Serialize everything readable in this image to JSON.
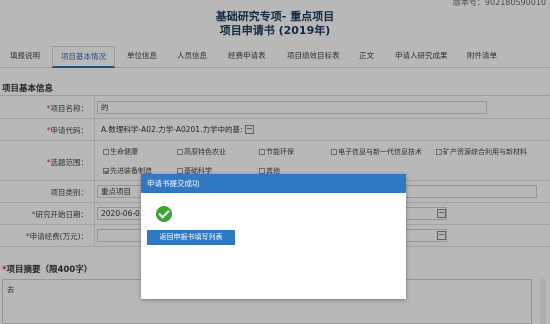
{
  "version_text": "版本号：902180590010",
  "header": {
    "title_line1": "基础研究专项- 重点项目",
    "title_line2": "项目申请书 (2019年)"
  },
  "tabs": [
    {
      "label": "填报说明",
      "active": false
    },
    {
      "label": "项目基本情况",
      "active": true
    },
    {
      "label": "单位信息",
      "active": false
    },
    {
      "label": "人员信息",
      "active": false
    },
    {
      "label": "经费申请表",
      "active": false
    },
    {
      "label": "项目绩效目标表",
      "active": false
    },
    {
      "label": "正文",
      "active": false
    },
    {
      "label": "申请人研究成果",
      "active": false
    },
    {
      "label": "附件清单",
      "active": false
    }
  ],
  "section_title": "项目基本信息",
  "form": {
    "project_name": {
      "label": "项目名称：",
      "required": "*",
      "value": "的"
    },
    "apply_code": {
      "label": "申请代码：",
      "required": "*",
      "value": "A.数理科学-A02.力学-A0201.力学中的基:"
    },
    "topic_range": {
      "label": "选题范围：",
      "required": "*",
      "options": [
        {
          "label": "生命健康",
          "checked": false
        },
        {
          "label": "高原特色农业",
          "checked": false
        },
        {
          "label": "节能环保",
          "checked": false
        },
        {
          "label": "电子信息与新一代信息技术",
          "checked": false
        },
        {
          "label": "矿产资源综合利用与新材料",
          "checked": false
        },
        {
          "label": "先进装备制造",
          "checked": true
        },
        {
          "label": "基础科学",
          "checked": false
        },
        {
          "label": "其他",
          "checked": false
        }
      ]
    },
    "project_category": {
      "label": "项目类别：",
      "required": "",
      "value": "重点项目"
    },
    "start_date": {
      "label": "研究开始日期：",
      "required": "*",
      "value": "2020-06-01"
    },
    "funding": {
      "label": "申请经费(万元)：",
      "required": "*",
      "value": ""
    }
  },
  "abstract": {
    "required": "*",
    "title": "项目摘要（限400字）",
    "value": "去"
  },
  "dialog": {
    "title": "申请书提交成功",
    "button_label": "返回申报书填写列表"
  },
  "colors": {
    "accent": "#2f78c4",
    "success": "#3aa635",
    "required": "#d9302c"
  }
}
